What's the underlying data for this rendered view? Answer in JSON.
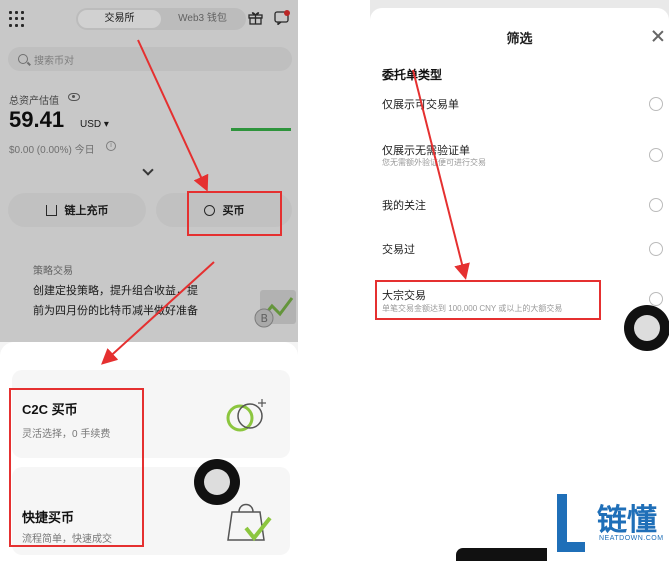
{
  "left": {
    "header": {
      "tabs": [
        "交易所",
        "Web3 钱包"
      ],
      "active_tab": 0,
      "icons": [
        "grid-icon",
        "gift-icon",
        "chat-icon"
      ]
    },
    "search": {
      "placeholder": "搜索币对"
    },
    "assets": {
      "label": "总资产估值",
      "balance": "59.41",
      "currency": "USD ▾",
      "today": "$0.00 (0.00%) 今日"
    },
    "actions": {
      "deposit_label": "链上充币",
      "buy_label": "买币"
    },
    "strategy": {
      "label": "策略交易",
      "line1": "创建定投策略，提升组合收益，提",
      "line2": "前为四月份的比特币减半做好准备"
    },
    "buy_options": [
      {
        "title": "C2C 买币",
        "subtitle": "灵活选择，0 手续费"
      },
      {
        "title": "快捷买币",
        "subtitle": "流程简单，快速成交"
      }
    ]
  },
  "right": {
    "title": "筛选",
    "section_title": "委托单类型",
    "options": [
      {
        "label": "仅展示可交易单",
        "desc": ""
      },
      {
        "label": "仅展示无需验证单",
        "desc": "您无需额外验证便可进行交易"
      },
      {
        "label": "我的关注",
        "desc": ""
      },
      {
        "label": "交易过",
        "desc": ""
      },
      {
        "label": "大宗交易",
        "desc": "单笔交易金额达到 100,000 CNY 或以上的大额交易"
      }
    ]
  },
  "watermark": {
    "title": "链懂",
    "sub": "NEATDOWN.COM"
  },
  "colors": {
    "annotation_red": "#e53030",
    "accent_green": "#39b54a",
    "watermark_blue": "#1f6fb8"
  }
}
